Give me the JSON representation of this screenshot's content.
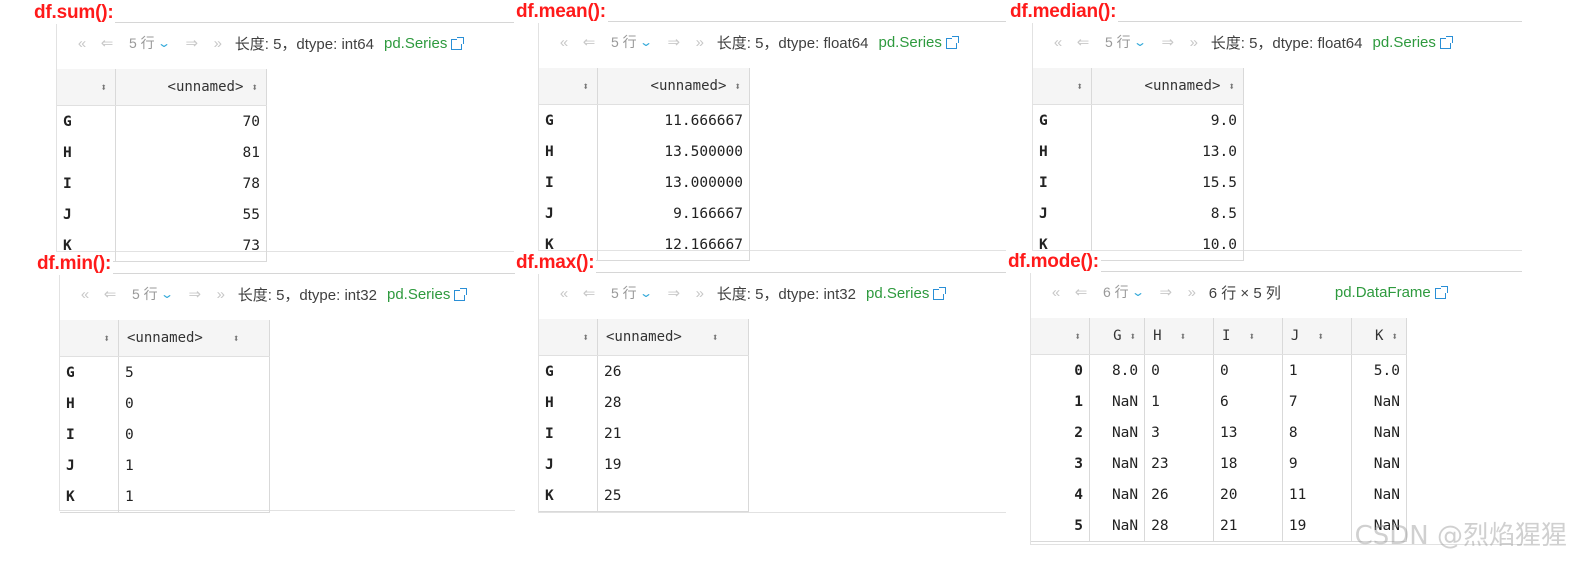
{
  "panels": {
    "sum": {
      "title": "df.sum():",
      "rows_label": "5 行",
      "info": "长度: 5，dtype: int64",
      "type_link": "pd.Series",
      "header": "<unnamed>",
      "index": [
        "G",
        "H",
        "I",
        "J",
        "K"
      ],
      "values": [
        "70",
        "81",
        "78",
        "55",
        "73"
      ]
    },
    "mean": {
      "title": "df.mean():",
      "rows_label": "5 行",
      "info": "长度: 5，dtype: float64",
      "type_link": "pd.Series",
      "header": "<unnamed>",
      "index": [
        "G",
        "H",
        "I",
        "J",
        "K"
      ],
      "values": [
        "11.666667",
        "13.500000",
        "13.000000",
        "9.166667",
        "12.166667"
      ]
    },
    "median": {
      "title": "df.median():",
      "rows_label": "5 行",
      "info": "长度: 5，dtype: float64",
      "type_link": "pd.Series",
      "header": "<unnamed>",
      "index": [
        "G",
        "H",
        "I",
        "J",
        "K"
      ],
      "values": [
        "9.0",
        "13.0",
        "15.5",
        "8.5",
        "10.0"
      ]
    },
    "min": {
      "title": "df.min():",
      "rows_label": "5 行",
      "info": "长度: 5，dtype: int32",
      "type_link": "pd.Series",
      "header": "<unnamed>",
      "index": [
        "G",
        "H",
        "I",
        "J",
        "K"
      ],
      "values": [
        "5",
        "0",
        "0",
        "1",
        "1"
      ]
    },
    "max": {
      "title": "df.max():",
      "rows_label": "5 行",
      "info": "长度: 5，dtype: int32",
      "type_link": "pd.Series",
      "header": "<unnamed>",
      "index": [
        "G",
        "H",
        "I",
        "J",
        "K"
      ],
      "values": [
        "26",
        "28",
        "21",
        "19",
        "25"
      ]
    },
    "mode": {
      "title": "df.mode():",
      "rows_label": "6 行",
      "info": "6 行 × 5 列",
      "type_link": "pd.DataFrame",
      "columns": [
        "G",
        "H",
        "I",
        "J",
        "K"
      ],
      "index": [
        "0",
        "1",
        "2",
        "3",
        "4",
        "5"
      ],
      "rows": [
        [
          "8.0",
          "0",
          "0",
          "1",
          "5.0"
        ],
        [
          "NaN",
          "1",
          "6",
          "7",
          "NaN"
        ],
        [
          "NaN",
          "3",
          "13",
          "8",
          "NaN"
        ],
        [
          "NaN",
          "23",
          "18",
          "9",
          "NaN"
        ],
        [
          "NaN",
          "26",
          "20",
          "11",
          "NaN"
        ],
        [
          "NaN",
          "28",
          "21",
          "19",
          "NaN"
        ]
      ]
    }
  },
  "icons": {
    "first": "«",
    "prev": "⇐",
    "next": "⇒",
    "last": "»",
    "sort": "⬍",
    "dropdown": "⌄"
  },
  "watermark": "CSDN @烈焰猩猩",
  "colors": {
    "title": "#ff1a1a",
    "series_link": "#2e9a3e",
    "accent": "#2a8fd6"
  }
}
